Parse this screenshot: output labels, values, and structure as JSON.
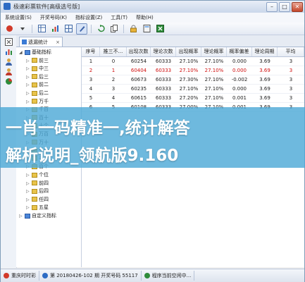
{
  "window": {
    "title": "极速彩票软件[高级选号版]",
    "btn_min": "–",
    "btn_max": "□",
    "btn_close": "✕"
  },
  "menu": [
    "系统设置(S)",
    "开奖号码(K)",
    "指标设置(Z)",
    "工具(T)",
    "帮助(H)"
  ],
  "toolbar": {
    "icons": [
      "record-icon",
      "table-icon",
      "chart-icon",
      "grid-icon",
      "grid2-icon",
      "pen-icon",
      "refresh-icon",
      "copy-icon",
      "lock-icon",
      "calc-icon",
      "excel-icon"
    ]
  },
  "tab": {
    "label": "遗漏统计",
    "close": "×"
  },
  "tree": {
    "items": [
      {
        "label": "基础指标",
        "level": 0,
        "type": "folder",
        "expanded": true
      },
      {
        "label": "前三",
        "level": 1,
        "type": "leaf"
      },
      {
        "label": "中三",
        "level": 1,
        "type": "leaf"
      },
      {
        "label": "后三",
        "level": 1,
        "type": "leaf"
      },
      {
        "label": "前二",
        "level": 1,
        "type": "leaf"
      },
      {
        "label": "后二",
        "level": 1,
        "type": "leaf"
      },
      {
        "label": "万千",
        "level": 1,
        "type": "leaf"
      },
      {
        "label": "千百",
        "level": 1,
        "type": "leaf"
      },
      {
        "label": "百十",
        "level": 1,
        "type": "leaf"
      },
      {
        "label": "十个",
        "level": 1,
        "type": "leaf"
      },
      {
        "label": "万百",
        "level": 1,
        "type": "leaf"
      },
      {
        "label": "万十",
        "level": 1,
        "type": "leaf"
      },
      {
        "label": "千十",
        "level": 1,
        "type": "leaf"
      },
      {
        "label": "千个",
        "level": 1,
        "type": "leaf"
      },
      {
        "label": "百个",
        "level": 1,
        "type": "leaf"
      },
      {
        "label": "个位",
        "level": 1,
        "type": "leaf"
      },
      {
        "label": "前四",
        "level": 1,
        "type": "leaf"
      },
      {
        "label": "后四",
        "level": 1,
        "type": "leaf"
      },
      {
        "label": "任四",
        "level": 1,
        "type": "leaf"
      },
      {
        "label": "五星",
        "level": 1,
        "type": "leaf"
      },
      {
        "label": "自定义指标",
        "level": 0,
        "type": "folder",
        "expanded": false
      }
    ]
  },
  "grid": {
    "columns": [
      "序号",
      "推三不...",
      "出现次数",
      "理论次数",
      "出现概率",
      "理论概率",
      "概率偏差",
      "理论周期",
      "平均"
    ],
    "rows": [
      {
        "cells": [
          "1",
          "0",
          "60254",
          "60333",
          "27.10%",
          "27.10%",
          "0.000",
          "3.69",
          "3"
        ],
        "red": false
      },
      {
        "cells": [
          "2",
          "1",
          "60404",
          "60333",
          "27.10%",
          "27.10%",
          "0.000",
          "3.69",
          "3"
        ],
        "red": true
      },
      {
        "cells": [
          "3",
          "2",
          "60673",
          "60333",
          "27.30%",
          "27.10%",
          "-0.002",
          "3.69",
          "3"
        ],
        "red": false
      },
      {
        "cells": [
          "4",
          "3",
          "60235",
          "60333",
          "27.10%",
          "27.10%",
          "0.000",
          "3.69",
          "3"
        ],
        "red": false
      },
      {
        "cells": [
          "5",
          "4",
          "60615",
          "60333",
          "27.20%",
          "27.10%",
          "0.001",
          "3.69",
          "3"
        ],
        "red": false
      },
      {
        "cells": [
          "6",
          "5",
          "60108",
          "60333",
          "27.00%",
          "27.10%",
          "0.001",
          "3.69",
          "3"
        ],
        "red": false
      }
    ]
  },
  "overlay": {
    "line1": "一肖一码精准一,统计解答",
    "line2": "解析说明_领航版9.160"
  },
  "status": {
    "s1": "重庆时时彩",
    "s2": "第 20180426-102 期 开奖号码 55117",
    "s3": "程序当前空闲中..."
  }
}
